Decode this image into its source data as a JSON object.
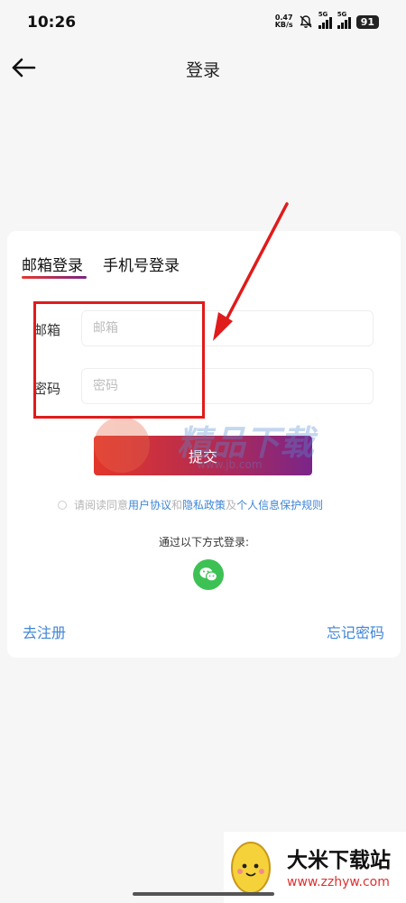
{
  "status_bar": {
    "time": "10:26",
    "net_speed_value": "0.47",
    "net_speed_unit": "KB/s",
    "sim1_label": "5G",
    "sim2_label": "5G",
    "battery": "91",
    "icons": [
      "mute-bell-icon",
      "signal-icon",
      "signal-icon",
      "battery-icon"
    ]
  },
  "header": {
    "title": "登录",
    "back_icon": "arrow-left-icon"
  },
  "tabs": [
    {
      "label": "邮箱登录",
      "active": true
    },
    {
      "label": "手机号登录",
      "active": false
    }
  ],
  "form": {
    "email_label": "邮箱",
    "email_placeholder": "邮箱",
    "email_value": "",
    "password_label": "密码",
    "password_placeholder": "密码",
    "password_value": "",
    "submit_label": "提交"
  },
  "agreement": {
    "prefix": "请阅读同意",
    "user_agreement": "用户协议",
    "and": "和",
    "privacy_policy": "隐私政策",
    "also": "及",
    "personal_info_rules": "个人信息保护规则",
    "checked": false
  },
  "other_login": {
    "label": "通过以下方式登录:",
    "wechat_icon": "wechat-icon"
  },
  "footer_links": {
    "register": "去注册",
    "forgot_password": "忘记密码"
  },
  "watermark": {
    "text": "精品下载",
    "url": "www.jb.com"
  },
  "brand_badge": {
    "name": "大米下载站",
    "url": "www.zzhyw.com"
  },
  "colors": {
    "accent_link": "#3f86d6",
    "submit_gradient_start": "#e2362b",
    "submit_gradient_end": "#7a2589",
    "wechat_green": "#3dc154",
    "annotation_red": "#e01b1b",
    "page_background": "#f6f6f6"
  }
}
